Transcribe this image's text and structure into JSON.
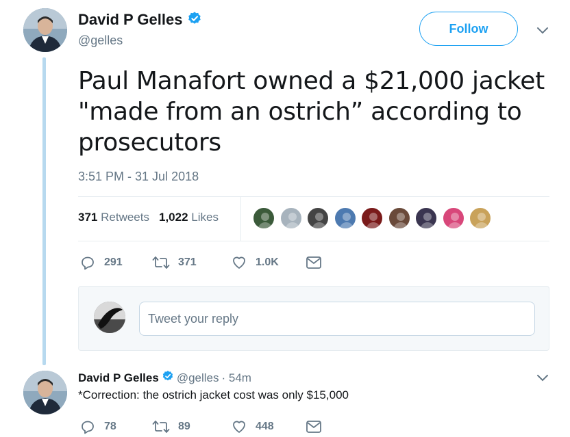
{
  "main_tweet": {
    "author_name": "David P Gelles",
    "handle": "@gelles",
    "follow_label": "Follow",
    "text": "Paul Manafort owned a $21,000 jacket \"made from an ostrich” according to prosecutors",
    "timestamp": "3:51 PM - 31 Jul 2018",
    "retweets_count": "371",
    "retweets_label": "Retweets",
    "likes_count": "1,022",
    "likes_label": "Likes",
    "actions": {
      "replies": "291",
      "retweets": "371",
      "likes": "1.0K"
    }
  },
  "reply_composer": {
    "placeholder": "Tweet your reply"
  },
  "reply_tweet": {
    "author_name": "David P Gelles",
    "handle": "@gelles",
    "time": "· 54m",
    "text": "*Correction: the ostrich jacket cost was only $15,000",
    "actions": {
      "replies": "78",
      "retweets": "89",
      "likes": "448"
    }
  },
  "liker_avatars": [
    "#3b5a3a",
    "#a7b3bd",
    "#444444",
    "#4d7ab0",
    "#7a1a1a",
    "#6a4a3a",
    "#3a3550",
    "#d8477a",
    "#c9a25a"
  ],
  "colors": {
    "accent": "#1da1f2",
    "muted": "#657786",
    "thread_line": "#b7d9ef",
    "verified": "#1da1f2"
  }
}
